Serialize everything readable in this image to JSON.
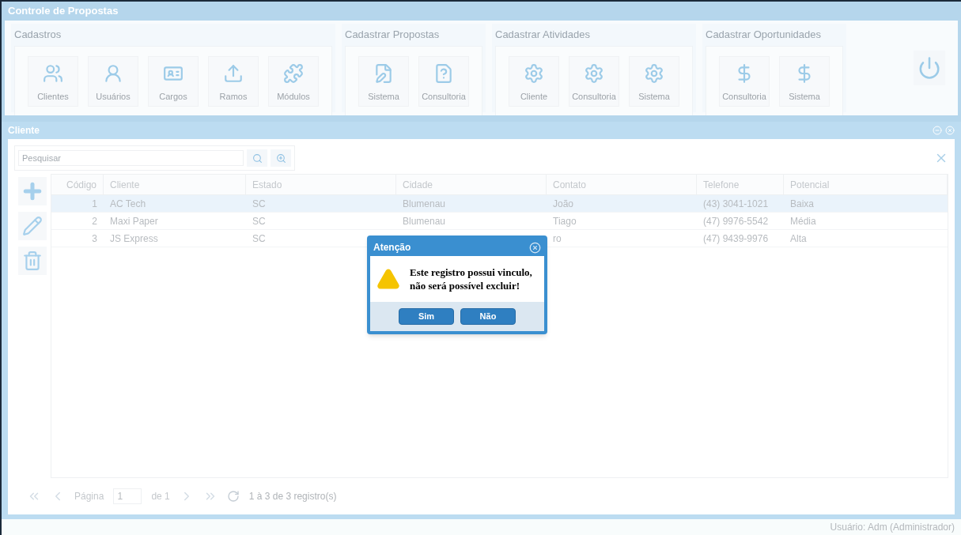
{
  "window": {
    "title": "Controle de Propostas"
  },
  "toolbar_groups": [
    {
      "title": "Cadastros",
      "buttons": [
        "Clientes",
        "Usuários",
        "Cargos",
        "Ramos",
        "Módulos"
      ]
    },
    {
      "title": "Cadastrar Propostas",
      "buttons": [
        "Sistema",
        "Consultoria"
      ]
    },
    {
      "title": "Cadastrar Atividades",
      "buttons": [
        "Cliente",
        "Consultoria",
        "Sistema"
      ]
    },
    {
      "title": "Cadastrar Oportunidades",
      "buttons": [
        "Consultoria",
        "Sistema"
      ]
    }
  ],
  "panel": {
    "title": "Cliente",
    "search": {
      "placeholder": "Pesquisar"
    },
    "table": {
      "columns": [
        "Código",
        "Cliente",
        "Estado",
        "Cidade",
        "Contato",
        "Telefone",
        "Potencial"
      ],
      "rows": [
        {
          "selected": true,
          "cells": [
            "1",
            "AC Tech",
            "SC",
            "Blumenau",
            "João",
            "(43) 3041-1021",
            "Baixa"
          ]
        },
        {
          "selected": false,
          "cells": [
            "2",
            "Maxi Paper",
            "SC",
            "Blumenau",
            "Tiago",
            "(47) 9976-5542",
            "Média"
          ]
        },
        {
          "selected": false,
          "cells": [
            "3",
            "JS Express",
            "SC",
            "",
            "ro",
            "(47) 9439-9976",
            "Alta"
          ]
        }
      ]
    },
    "pager": {
      "page_label": "Página",
      "page": "1",
      "of": "de 1",
      "summary": "1 à 3 de 3 registro(s)"
    }
  },
  "dialog": {
    "title": "Atenção",
    "message": "Este registro possui vinculo, não será possível excluir!",
    "buttons": [
      "Sim",
      "Não"
    ]
  },
  "status_bar": "Usuário: Adm (Administrador)"
}
